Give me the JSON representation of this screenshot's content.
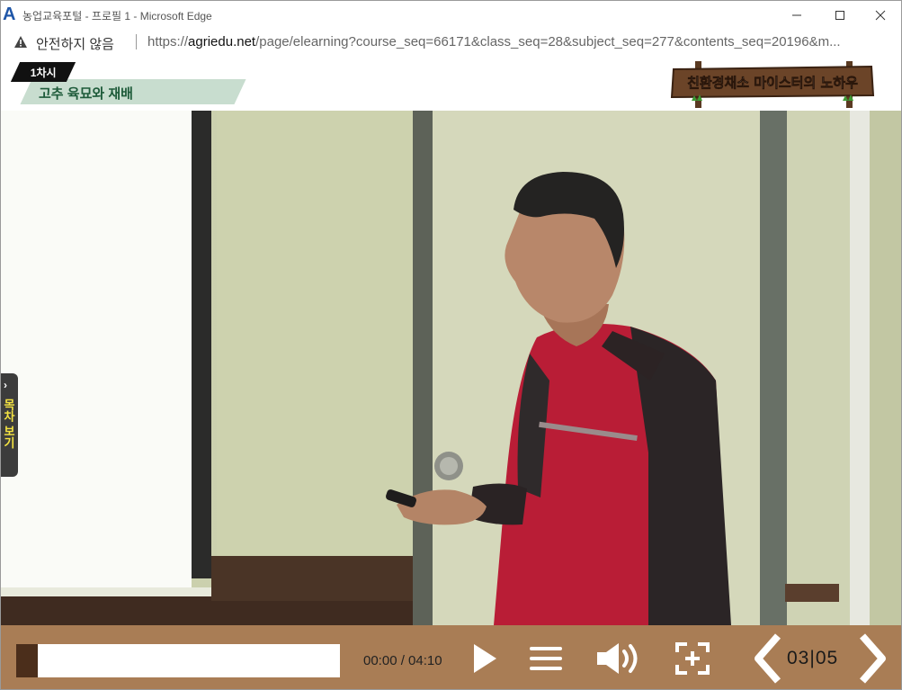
{
  "window": {
    "title": "농업교육포털 - 프로필 1 - Microsoft Edge",
    "app_logo": "A"
  },
  "address_bar": {
    "security_label": "안전하지 않음",
    "url_prefix": "https://",
    "url_domain": "agriedu.net",
    "url_path": "/page/elearning?course_seq=66171&class_seq=28&subject_seq=277&contents_seq=20196&m..."
  },
  "lesson": {
    "session_badge": "1차시",
    "topic": "고추 육묘와 재배",
    "series_sign": "친환경채소 마이스터의 노하우"
  },
  "toc": {
    "arrow": "›",
    "label": "목차 보기"
  },
  "player": {
    "progress": 0.066,
    "time": "00:00 / 04:10",
    "page_current": "03",
    "page_sep": "|",
    "page_total": "05"
  },
  "icons": {
    "minimize": "minimize-icon",
    "maximize": "maximize-icon",
    "close": "close-icon",
    "warning": "warning-icon",
    "play": "play-icon",
    "menu": "menu-icon",
    "volume": "volume-icon",
    "fullscreen": "fullscreen-icon",
    "prev": "chevron-left-icon",
    "next": "chevron-right-icon"
  },
  "colors": {
    "control_bar": "#a97d55",
    "progress_fill": "#4b2e1b",
    "topic_band": "#c8ddcf",
    "topic_text": "#1e5b3a",
    "toc_label": "#f5e442"
  }
}
